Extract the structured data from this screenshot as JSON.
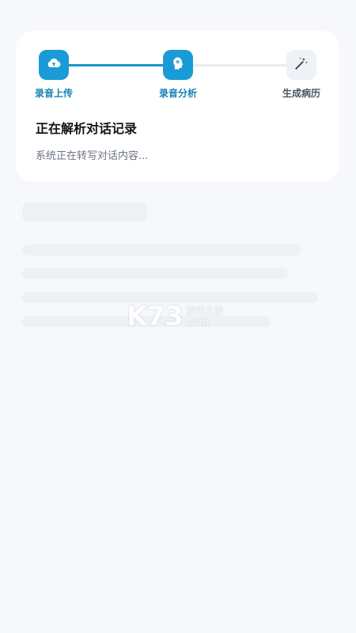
{
  "steps": [
    {
      "label": "录音上传",
      "status": "done",
      "icon": "cloud-upload-icon"
    },
    {
      "label": "录音分析",
      "status": "active",
      "icon": "head-analysis-icon"
    },
    {
      "label": "生成病历",
      "status": "pending",
      "icon": "magic-wand-icon"
    }
  ],
  "status_card": {
    "title": "正在解析对话记录",
    "subtitle": "系统正在转写对话内容..."
  },
  "watermark": {
    "logo": "K73",
    "line1": "游戏之家",
    "line2": ".com"
  },
  "colors": {
    "accent": "#1a9bd7",
    "accent_text": "#1582b5",
    "background": "#f6f8fb",
    "skeleton": "#edf1f6"
  }
}
